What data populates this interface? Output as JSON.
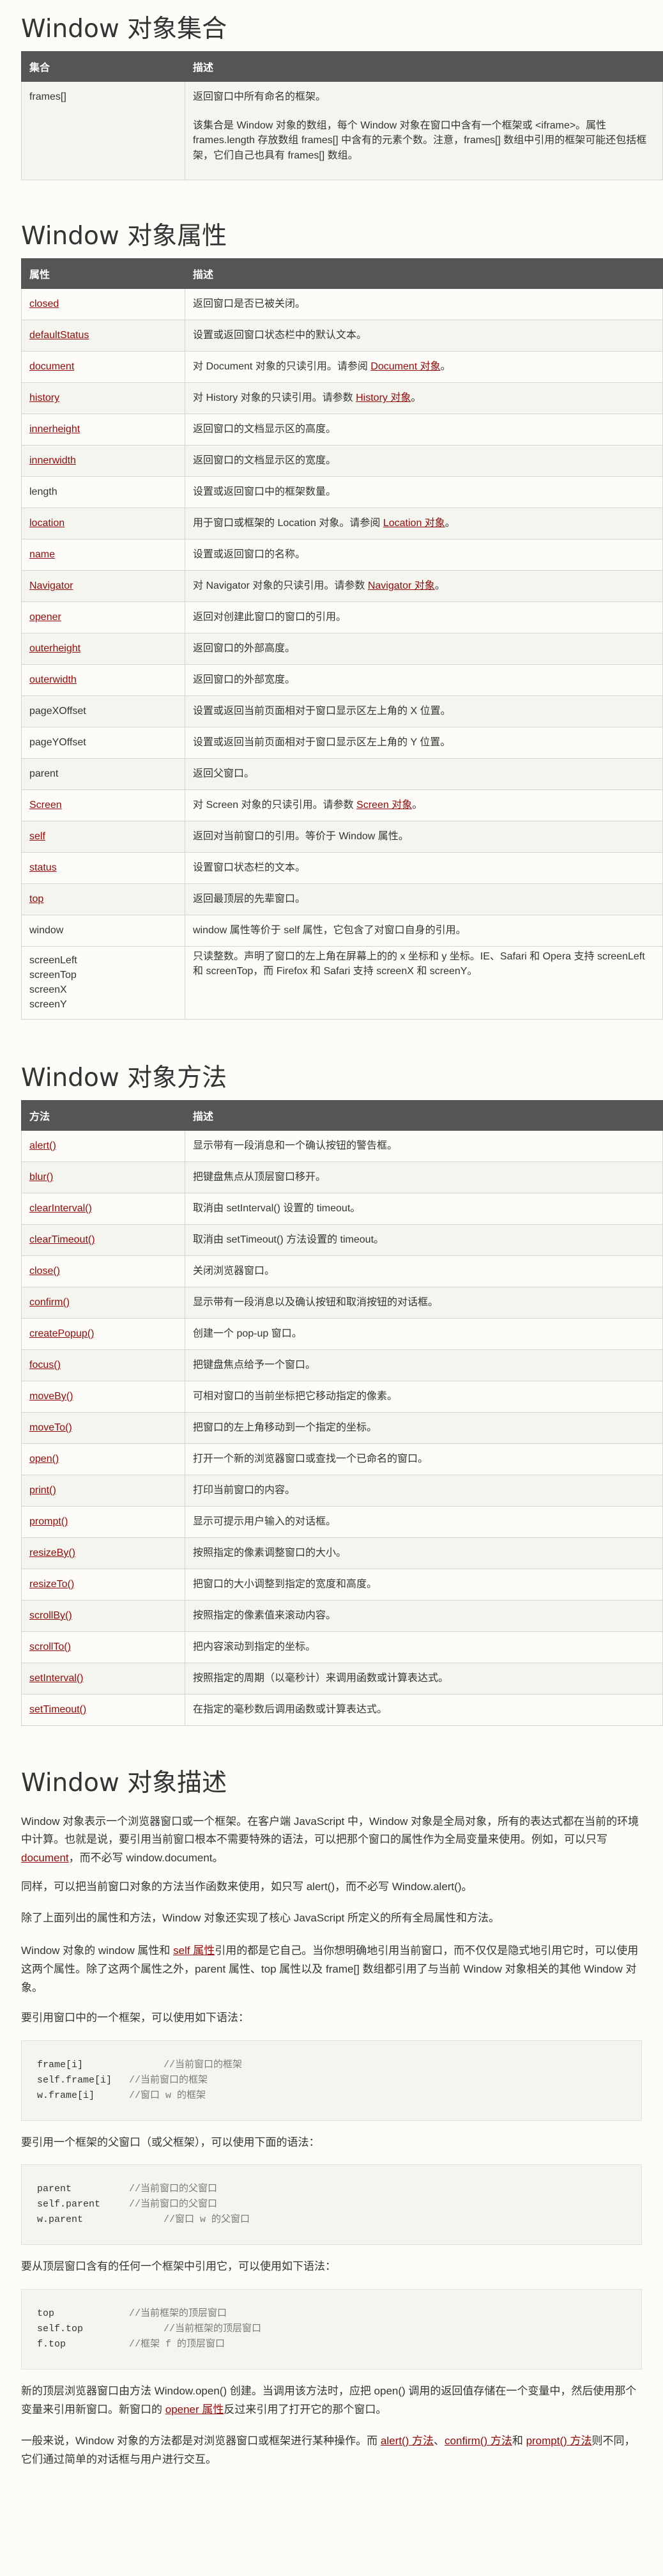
{
  "collection": {
    "title": "Window 对象集合",
    "headers": [
      "集合",
      "描述"
    ],
    "row_name": "frames[]",
    "row_desc_1": "返回窗口中所有命名的框架。",
    "row_desc_2": "该集合是 Window 对象的数组，每个 Window 对象在窗口中含有一个框架或 <iframe>。属性 frames.length 存放数组 frames[] 中含有的元素个数。注意，frames[] 数组中引用的框架可能还包括框架，它们自己也具有 frames[] 数组。"
  },
  "properties": {
    "title": "Window 对象属性",
    "headers": [
      "属性",
      "描述"
    ],
    "rows": [
      {
        "name": "closed",
        "link": true,
        "pre": "返回窗口是否已被关闭。",
        "ref": "",
        "post": ""
      },
      {
        "name": "defaultStatus",
        "link": true,
        "pre": "设置或返回窗口状态栏中的默认文本。",
        "ref": "",
        "post": ""
      },
      {
        "name": "document",
        "link": true,
        "pre": "对 Document 对象的只读引用。请参阅 ",
        "ref": "Document 对象",
        "post": "。"
      },
      {
        "name": "history",
        "link": true,
        "pre": "对 History 对象的只读引用。请参数 ",
        "ref": "History 对象",
        "post": "。"
      },
      {
        "name": "innerheight",
        "link": true,
        "pre": "返回窗口的文档显示区的高度。",
        "ref": "",
        "post": ""
      },
      {
        "name": "innerwidth",
        "link": true,
        "pre": "返回窗口的文档显示区的宽度。",
        "ref": "",
        "post": ""
      },
      {
        "name": "length",
        "link": false,
        "pre": "设置或返回窗口中的框架数量。",
        "ref": "",
        "post": ""
      },
      {
        "name": "location",
        "link": true,
        "pre": "用于窗口或框架的 Location 对象。请参阅 ",
        "ref": "Location 对象",
        "post": "。"
      },
      {
        "name": "name",
        "link": true,
        "pre": "设置或返回窗口的名称。",
        "ref": "",
        "post": ""
      },
      {
        "name": "Navigator",
        "link": true,
        "pre": "对 Navigator 对象的只读引用。请参数 ",
        "ref": "Navigator 对象",
        "post": "。"
      },
      {
        "name": "opener",
        "link": true,
        "pre": "返回对创建此窗口的窗口的引用。",
        "ref": "",
        "post": ""
      },
      {
        "name": "outerheight",
        "link": true,
        "pre": "返回窗口的外部高度。",
        "ref": "",
        "post": ""
      },
      {
        "name": "outerwidth",
        "link": true,
        "pre": "返回窗口的外部宽度。",
        "ref": "",
        "post": ""
      },
      {
        "name": "pageXOffset",
        "link": false,
        "pre": "设置或返回当前页面相对于窗口显示区左上角的 X 位置。",
        "ref": "",
        "post": ""
      },
      {
        "name": "pageYOffset",
        "link": false,
        "pre": "设置或返回当前页面相对于窗口显示区左上角的 Y 位置。",
        "ref": "",
        "post": ""
      },
      {
        "name": "parent",
        "link": false,
        "pre": "返回父窗口。",
        "ref": "",
        "post": ""
      },
      {
        "name": "Screen",
        "link": true,
        "pre": "对 Screen 对象的只读引用。请参数 ",
        "ref": "Screen 对象",
        "post": "。"
      },
      {
        "name": "self",
        "link": true,
        "pre": "返回对当前窗口的引用。等价于 Window 属性。",
        "ref": "",
        "post": ""
      },
      {
        "name": "status",
        "link": true,
        "pre": "设置窗口状态栏的文本。",
        "ref": "",
        "post": ""
      },
      {
        "name": "top",
        "link": true,
        "pre": "返回最顶层的先辈窗口。",
        "ref": "",
        "post": ""
      },
      {
        "name": "window",
        "link": false,
        "pre": "window 属性等价于 self 属性，它包含了对窗口自身的引用。",
        "ref": "",
        "post": ""
      }
    ],
    "screen_row_names": "screenLeft\nscreenTop\nscreenX\nscreenY",
    "screen_row_desc": "只读整数。声明了窗口的左上角在屏幕上的的 x 坐标和 y 坐标。IE、Safari 和 Opera 支持 screenLeft 和 screenTop，而 Firefox 和 Safari 支持 screenX 和 screenY。"
  },
  "methods": {
    "title": "Window 对象方法",
    "headers": [
      "方法",
      "描述"
    ],
    "rows": [
      {
        "name": "alert()",
        "desc": "显示带有一段消息和一个确认按钮的警告框。"
      },
      {
        "name": "blur()",
        "desc": "把键盘焦点从顶层窗口移开。"
      },
      {
        "name": "clearInterval()",
        "desc": "取消由 setInterval() 设置的 timeout。"
      },
      {
        "name": "clearTimeout()",
        "desc": "取消由 setTimeout() 方法设置的 timeout。"
      },
      {
        "name": "close()",
        "desc": "关闭浏览器窗口。"
      },
      {
        "name": "confirm()",
        "desc": "显示带有一段消息以及确认按钮和取消按钮的对话框。"
      },
      {
        "name": "createPopup()",
        "desc": "创建一个 pop-up 窗口。"
      },
      {
        "name": "focus()",
        "desc": "把键盘焦点给予一个窗口。"
      },
      {
        "name": "moveBy()",
        "desc": "可相对窗口的当前坐标把它移动指定的像素。"
      },
      {
        "name": "moveTo()",
        "desc": "把窗口的左上角移动到一个指定的坐标。"
      },
      {
        "name": "open()",
        "desc": "打开一个新的浏览器窗口或查找一个已命名的窗口。"
      },
      {
        "name": "print()",
        "desc": "打印当前窗口的内容。"
      },
      {
        "name": "prompt()",
        "desc": "显示可提示用户输入的对话框。"
      },
      {
        "name": "resizeBy()",
        "desc": "按照指定的像素调整窗口的大小。"
      },
      {
        "name": "resizeTo()",
        "desc": "把窗口的大小调整到指定的宽度和高度。"
      },
      {
        "name": "scrollBy()",
        "desc": "按照指定的像素值来滚动内容。"
      },
      {
        "name": "scrollTo()",
        "desc": "把内容滚动到指定的坐标。"
      },
      {
        "name": "setInterval()",
        "desc": "按照指定的周期（以毫秒计）来调用函数或计算表达式。"
      },
      {
        "name": "setTimeout()",
        "desc": "在指定的毫秒数后调用函数或计算表达式。"
      }
    ]
  },
  "description": {
    "title": "Window 对象描述",
    "p1_a": "Window 对象表示一个浏览器窗口或一个框架。在客户端 JavaScript 中，Window 对象是全局对象，所有的表达式都在当前的环境中计算。也就是说，要引用当前窗口根本不需要特殊的语法，可以把那个窗口的属性作为全局变量来使用。例如，可以只写 ",
    "p1_link": "document",
    "p1_b": "，而不必写 window.document。",
    "p2": "同样，可以把当前窗口对象的方法当作函数来使用，如只写 alert()，而不必写 Window.alert()。",
    "p3": "除了上面列出的属性和方法，Window 对象还实现了核心 JavaScript 所定义的所有全局属性和方法。",
    "p4_a": "Window 对象的 window 属性和 ",
    "p4_link": "self 属性",
    "p4_b": "引用的都是它自己。当你想明确地引用当前窗口，而不仅仅是隐式地引用它时，可以使用这两个属性。除了这两个属性之外，parent 属性、top 属性以及 frame[] 数组都引用了与当前 Window 对象相关的其他 Window 对象。",
    "p5": "要引用窗口中的一个框架，可以使用如下语法：",
    "code1": [
      {
        "code": "frame[i]              ",
        "comment": "//当前窗口的框架"
      },
      {
        "code": "self.frame[i]   ",
        "comment": "//当前窗口的框架"
      },
      {
        "code": "w.frame[i]      ",
        "comment": "//窗口 w 的框架"
      }
    ],
    "p6": "要引用一个框架的父窗口（或父框架），可以使用下面的语法：",
    "code2": [
      {
        "code": "parent          ",
        "comment": "//当前窗口的父窗口"
      },
      {
        "code": "self.parent     ",
        "comment": "//当前窗口的父窗口"
      },
      {
        "code": "w.parent              ",
        "comment": "//窗口 w 的父窗口"
      }
    ],
    "p7": "要从顶层窗口含有的任何一个框架中引用它，可以使用如下语法：",
    "code3": [
      {
        "code": "top             ",
        "comment": "//当前框架的顶层窗口"
      },
      {
        "code": "self.top              ",
        "comment": "//当前框架的顶层窗口"
      },
      {
        "code": "f.top           ",
        "comment": "//框架 f 的顶层窗口"
      }
    ],
    "p8_a": "新的顶层浏览器窗口由方法 Window.open() 创建。当调用该方法时，应把 open() 调用的返回值存储在一个变量中，然后使用那个变量来引用新窗口。新窗口的 ",
    "p8_link": "opener 属性",
    "p8_b": "反过来引用了打开它的那个窗口。",
    "p9_a": "一般来说，Window 对象的方法都是对浏览器窗口或框架进行某种操作。而 ",
    "p9_link1": "alert() 方法",
    "p9_sep1": "、",
    "p9_link2": "confirm() 方法",
    "p9_sep2": "和 ",
    "p9_link3": "prompt() 方法",
    "p9_b": "则不同，它们通过简单的对话框与用户进行交互。"
  },
  "colors": {
    "link": "#900b09",
    "header_bg": "#555555",
    "page_bg": "#fdfcf8",
    "alt_row": "#f5f5f0"
  }
}
